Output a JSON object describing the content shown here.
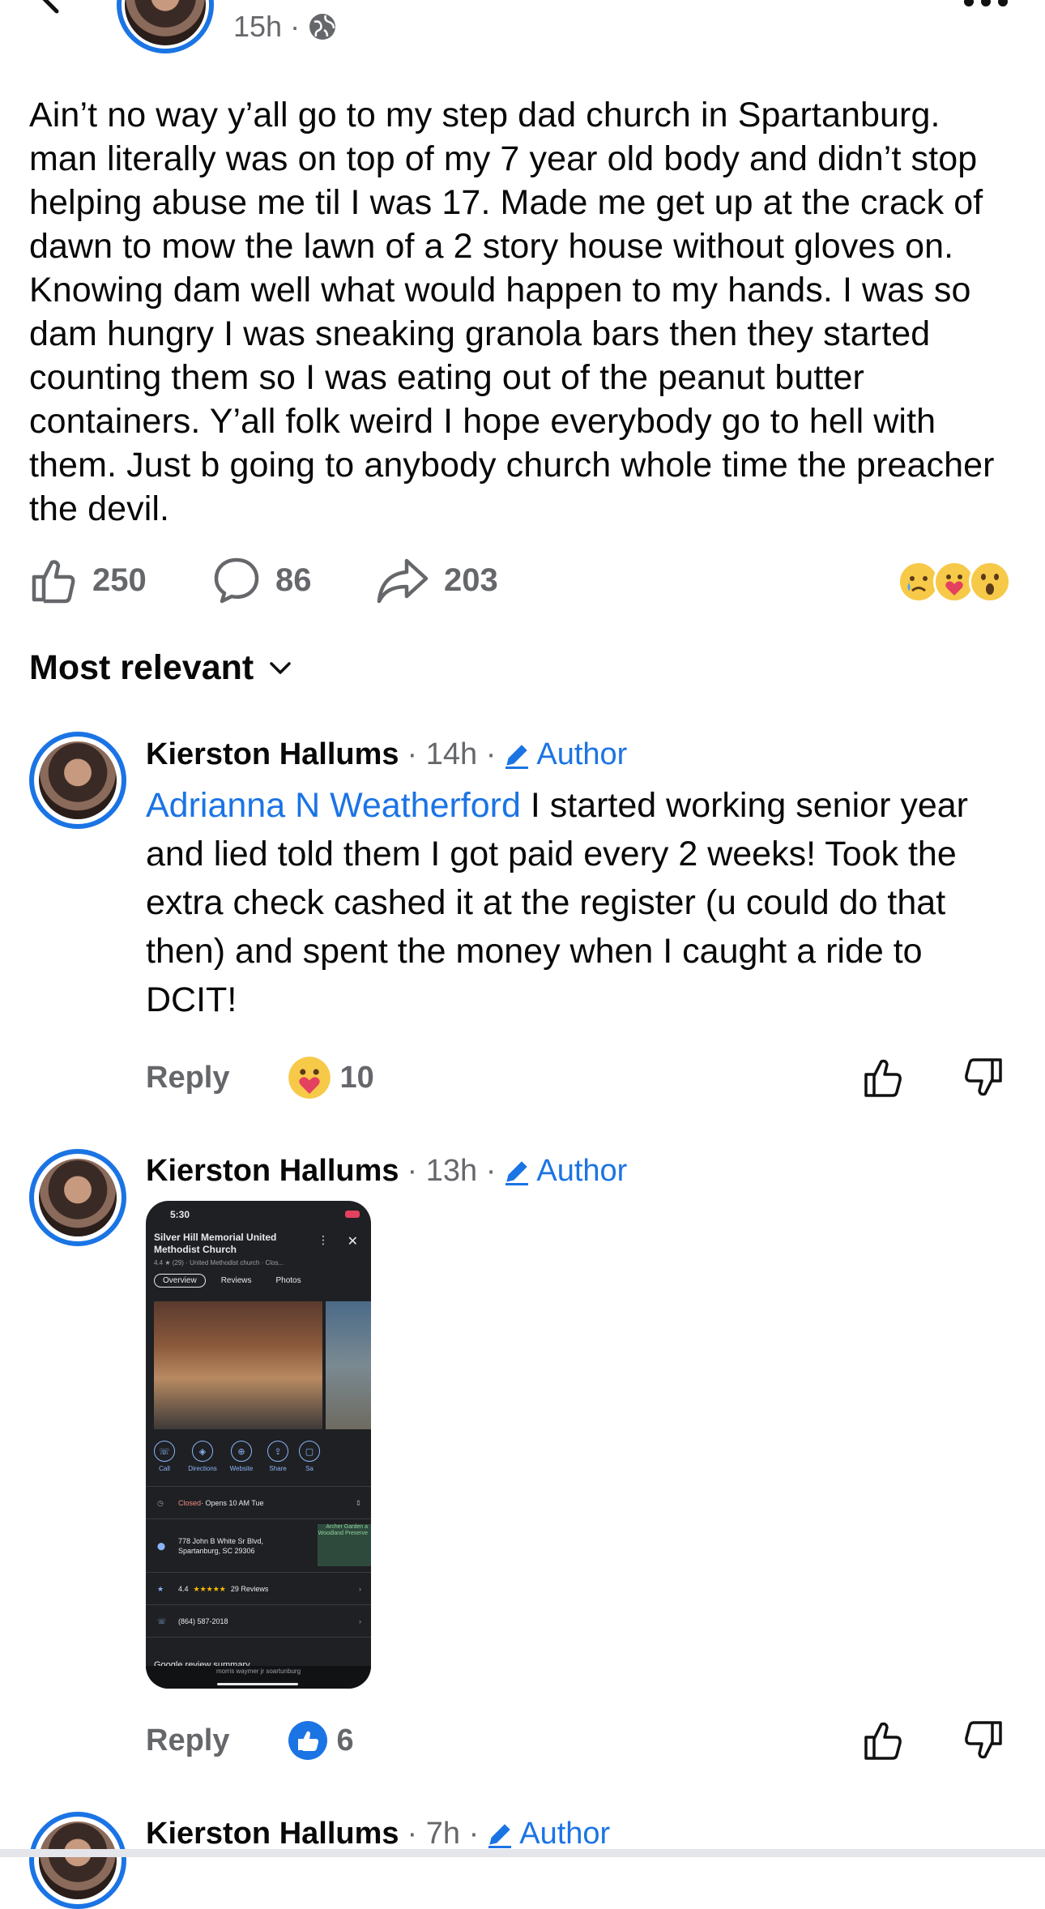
{
  "post": {
    "time": "15h",
    "visibility_icon": "globe-icon",
    "text": "Ain’t no way y’all go to my step dad church in Spartanburg. man literally was on top of my 7 year old body and didn’t stop helping abuse me til I was 17. Made me get up at the crack of dawn to mow the lawn of a 2 story house without gloves on. Knowing dam well what would happen to my hands. I was so dam hungry I was sneaking granola bars then they started counting them so I was eating out of the peanut butter containers. Y’all folk weird I hope everybody go to hell with them. Just b going to anybody church whole time the preacher the devil.",
    "likes": "250",
    "comments": "86",
    "shares": "203",
    "reaction_icons": [
      "sad-emoji",
      "care-emoji",
      "wow-emoji"
    ]
  },
  "sort_label": "Most relevant",
  "comments": [
    {
      "name": "Kierston Hallums",
      "time": "· 14h ·",
      "badge": "Author",
      "mention": "Adrianna N Weatherford",
      "text": " I started working senior year and lied told them I got paid every 2 weeks! Took the extra check cashed it at the register (u could do that then) and spent the money when I caught a ride to DCIT!",
      "reply": "Reply",
      "reaction_count": "10"
    },
    {
      "name": "Kierston Hallums",
      "time": "· 13h ·",
      "badge": "Author",
      "reply": "Reply",
      "reaction_count": "6",
      "attachment": {
        "status_time": "5:30",
        "place_name": "Silver Hill Memorial United Methodist Church",
        "rating_line": "4.4 ★ (29) · United Methodist church · Clos...",
        "tabs": [
          "Overview",
          "Reviews",
          "Photos"
        ],
        "buttons": [
          "Call",
          "Directions",
          "Website",
          "Share",
          "Sa"
        ],
        "hours_closed": "Closed",
        "hours_open": " · Opens 10 AM Tue",
        "address": "778 John B White Sr Blvd, Spartanburg, SC 29306",
        "map_label": "Archer Garden a Woodland Preserve",
        "rating_row_value": "4.4",
        "rating_row_stars": "★★★★★",
        "rating_row_reviews": "29 Reviews",
        "phone": "(864) 587-2018",
        "review_summary": "Google review summary",
        "search_bar": "morris waymer jr soartunburg"
      }
    },
    {
      "name": "Kierston Hallums",
      "time": "· 7h ·",
      "badge": "Author"
    }
  ]
}
